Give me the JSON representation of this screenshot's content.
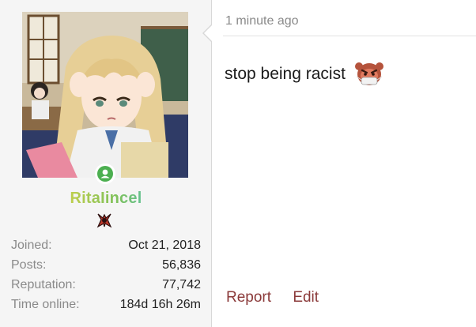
{
  "user": {
    "username": "RitaIincel",
    "avatar_icon": "anime-avatar",
    "online_status": "online",
    "rank_icon": "rank-emblem-icon",
    "stats": [
      {
        "label": "Joined:",
        "value": "Oct 21, 2018"
      },
      {
        "label": "Posts:",
        "value": "56,836"
      },
      {
        "label": "Reputation:",
        "value": "77,742"
      },
      {
        "label": "Time online:",
        "value": "184d 16h 26m"
      }
    ]
  },
  "post": {
    "timestamp": "1 minute ago",
    "message": "stop being racist",
    "emoji_icon": "angry-mask-emoji",
    "actions": {
      "report_label": "Report",
      "edit_label": "Edit"
    }
  },
  "colors": {
    "panel_bg": "#f5f5f5",
    "link": "#8b3a3a",
    "online": "#4caf50",
    "muted": "#8a8a8a"
  }
}
